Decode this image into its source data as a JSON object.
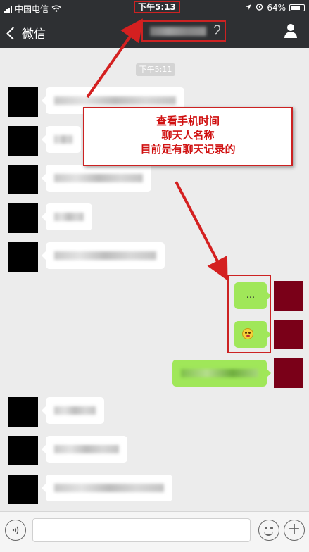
{
  "status_bar": {
    "carrier": "中国电信",
    "time": "下午5:13",
    "battery": "64%",
    "battery_level": 0.64
  },
  "nav": {
    "back_label": "微信"
  },
  "chat": {
    "timestamp": "下午5:11",
    "sent_messages": [
      {
        "text": "..."
      },
      {
        "text": ""
      },
      {
        "text": ""
      }
    ]
  },
  "annotation": {
    "lines": [
      "查看手机时间",
      "聊天人名称",
      "目前是有聊天记录的"
    ],
    "color": "#cc2222"
  },
  "colors": {
    "nav_bg": "#2e3033",
    "chat_bg": "#ececec",
    "sent_bubble": "#a0e759",
    "received_bubble": "#ffffff"
  },
  "icons": [
    "wifi-icon",
    "signal-icon",
    "location-icon",
    "alarm-icon",
    "battery-icon",
    "back-chevron-icon",
    "earpiece-icon",
    "person-icon",
    "voice-icon",
    "emoji-icon",
    "plus-icon"
  ]
}
